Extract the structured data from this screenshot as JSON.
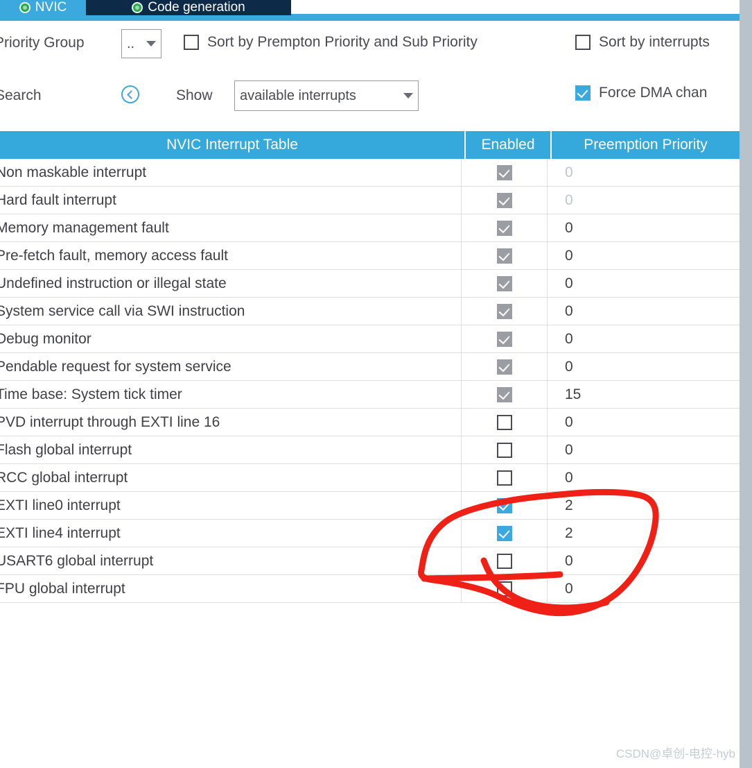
{
  "tabs": [
    {
      "label": "NVIC",
      "state": "active",
      "icon": "green-check-circle-icon"
    },
    {
      "label": "Code generation",
      "state": "inactive",
      "icon": "green-check-circle-icon"
    }
  ],
  "toolbar": {
    "priority_group_label": "Priority Group",
    "priority_group_value": "..",
    "sort_premption_label": "Sort by Prempton Priority and Sub Priority",
    "sort_premption_checked": false,
    "sort_interrupts_label": "Sort by interrupts",
    "sort_interrupts_checked": false,
    "search_label": "Search",
    "search_nav_icon": "circle-chevron-left-icon",
    "show_label": "Show",
    "show_value": "available interrupts",
    "force_dma_label": "Force DMA chan",
    "force_dma_checked": true
  },
  "table": {
    "columns": [
      {
        "key": "name",
        "header": "NVIC Interrupt Table"
      },
      {
        "key": "enabled",
        "header": "Enabled"
      },
      {
        "key": "priority",
        "header": "Preemption Priority"
      }
    ],
    "rows": [
      {
        "name": "Non maskable interrupt",
        "enabled": "disabled-checked",
        "priority": "0",
        "priority_dim": true
      },
      {
        "name": "Hard fault interrupt",
        "enabled": "disabled-checked",
        "priority": "0",
        "priority_dim": true
      },
      {
        "name": "Memory management fault",
        "enabled": "disabled-checked",
        "priority": "0",
        "priority_dim": false
      },
      {
        "name": "Pre-fetch fault, memory access fault",
        "enabled": "disabled-checked",
        "priority": "0",
        "priority_dim": false
      },
      {
        "name": "Undefined instruction or illegal state",
        "enabled": "disabled-checked",
        "priority": "0",
        "priority_dim": false
      },
      {
        "name": "System service call via SWI instruction",
        "enabled": "disabled-checked",
        "priority": "0",
        "priority_dim": false
      },
      {
        "name": "Debug monitor",
        "enabled": "disabled-checked",
        "priority": "0",
        "priority_dim": false
      },
      {
        "name": "Pendable request for system service",
        "enabled": "disabled-checked",
        "priority": "0",
        "priority_dim": false
      },
      {
        "name": "Time base: System tick timer",
        "enabled": "disabled-checked",
        "priority": "15",
        "priority_dim": false
      },
      {
        "name": "PVD interrupt through EXTI line 16",
        "enabled": "unchecked",
        "priority": "0",
        "priority_dim": false
      },
      {
        "name": "Flash global interrupt",
        "enabled": "unchecked",
        "priority": "0",
        "priority_dim": false
      },
      {
        "name": "RCC global interrupt",
        "enabled": "unchecked",
        "priority": "0",
        "priority_dim": false
      },
      {
        "name": "EXTI line0 interrupt",
        "enabled": "checked",
        "priority": "2",
        "priority_dim": false
      },
      {
        "name": "EXTI line4 interrupt",
        "enabled": "checked",
        "priority": "2",
        "priority_dim": false
      },
      {
        "name": "USART6 global interrupt",
        "enabled": "unchecked",
        "priority": "0",
        "priority_dim": false
      },
      {
        "name": "FPU global interrupt",
        "enabled": "unchecked",
        "priority": "0",
        "priority_dim": false
      }
    ]
  },
  "annotation": {
    "shape": "hand-drawn-red-circle",
    "color": "#ef2016"
  },
  "watermark": {
    "text": "CSDN@卓创-电控-hyb"
  },
  "colors": {
    "accent_blue": "#3ba9dd",
    "header_blue": "#35a8dc",
    "tab_dark": "#0d2a49",
    "annotation_red": "#ef2016",
    "disabled_check": "#9a9ea4"
  }
}
